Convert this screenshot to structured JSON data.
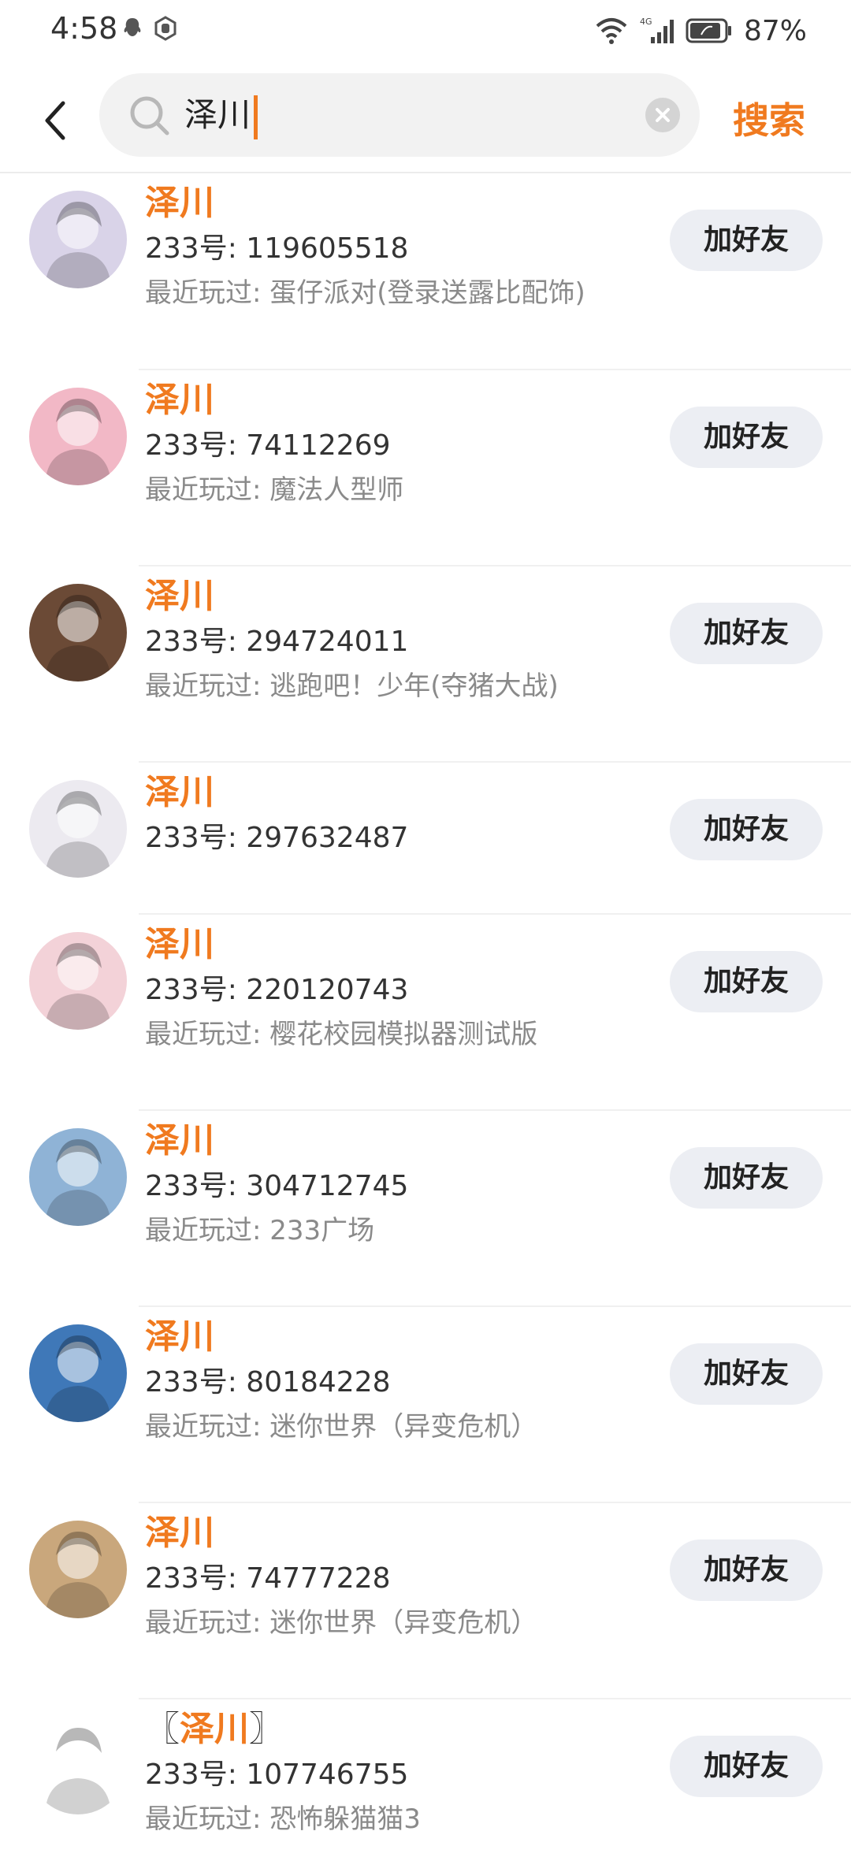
{
  "status_bar": {
    "time": "4:58",
    "battery": "87%"
  },
  "search": {
    "query": "泽川",
    "submit_label": "搜索"
  },
  "add_friend_label": "加好友",
  "results": [
    {
      "name": "泽川",
      "id": "233号: 119605518",
      "recent": "最近玩过: 蛋仔派对(登录送露比配饰)",
      "avatar_color": "#d9d3e8"
    },
    {
      "name": "泽川",
      "id": "233号: 74112269",
      "recent": "最近玩过: 魔法人型师",
      "avatar_color": "#f2b8c6"
    },
    {
      "name": "泽川",
      "id": "233号: 294724011",
      "recent": "最近玩过: 逃跑吧！少年(夺猪大战)",
      "avatar_color": "#6b4a36"
    },
    {
      "name": "泽川",
      "id": "233号: 297632487",
      "recent": "",
      "avatar_color": "#eceaf0"
    },
    {
      "name": "泽川",
      "id": "233号: 220120743",
      "recent": "最近玩过: 樱花校园模拟器测试版",
      "avatar_color": "#f3d2d8"
    },
    {
      "name": "泽川",
      "id": "233号: 304712745",
      "recent": "最近玩过: 233广场",
      "avatar_color": "#8fb3d6"
    },
    {
      "name": "泽川",
      "id": "233号: 80184228",
      "recent": "最近玩过: 迷你世界（异变危机）",
      "avatar_color": "#3f78b8"
    },
    {
      "name": "泽川",
      "id": "233号: 74777228",
      "recent": "最近玩过: 迷你世界（异变危机）",
      "avatar_color": "#c9a77c"
    },
    {
      "name": "泽川",
      "name_prefix": "〖",
      "name_suffix": "〗",
      "id": "233号: 107746755",
      "recent": "最近玩过: 恐怖躲猫猫3",
      "avatar_color": "#ffffff"
    }
  ],
  "colors": {
    "accent": "#f07a1f",
    "button_bg": "#eceef3",
    "secondary_text": "#8a8a8a"
  }
}
